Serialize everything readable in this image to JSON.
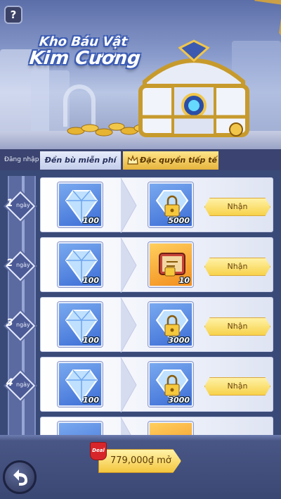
{
  "banner": {
    "title_line1": "Kho Báu Vật",
    "title_line2": "Kim Cương"
  },
  "help": {
    "label": "?"
  },
  "tabs": {
    "login_label": "Đăng nhập",
    "compensation_label": "Đền bù miễn phí",
    "privilege_label": "Đặc quyền tiếp tế"
  },
  "days": [
    {
      "num": "1",
      "unit": "ngày"
    },
    {
      "num": "2",
      "unit": "ngày"
    },
    {
      "num": "3",
      "unit": "ngày"
    },
    {
      "num": "4",
      "unit": "ngày"
    }
  ],
  "rows": [
    {
      "free_item": "diamond",
      "free_qty": "100",
      "locked_item": "locked-diamond",
      "locked_qty": "5000",
      "claim_label": "Nhận"
    },
    {
      "free_item": "diamond",
      "free_qty": "100",
      "locked_item": "scroll",
      "locked_qty": "10",
      "claim_label": "Nhận"
    },
    {
      "free_item": "diamond",
      "free_qty": "100",
      "locked_item": "locked-diamond",
      "locked_qty": "3000",
      "claim_label": "Nhận"
    },
    {
      "free_item": "diamond",
      "free_qty": "100",
      "locked_item": "locked-diamond",
      "locked_qty": "3000",
      "claim_label": "Nhận"
    }
  ],
  "footer": {
    "deal_badge": "Deal",
    "price_label": "779,000₫ mở"
  },
  "colors": {
    "accent_gold": "#f4c63e",
    "tab_active": "#e6b43c",
    "item_blue": "#3d6ed6",
    "item_orange": "#f28d1c",
    "deal_red": "#d7262b"
  }
}
